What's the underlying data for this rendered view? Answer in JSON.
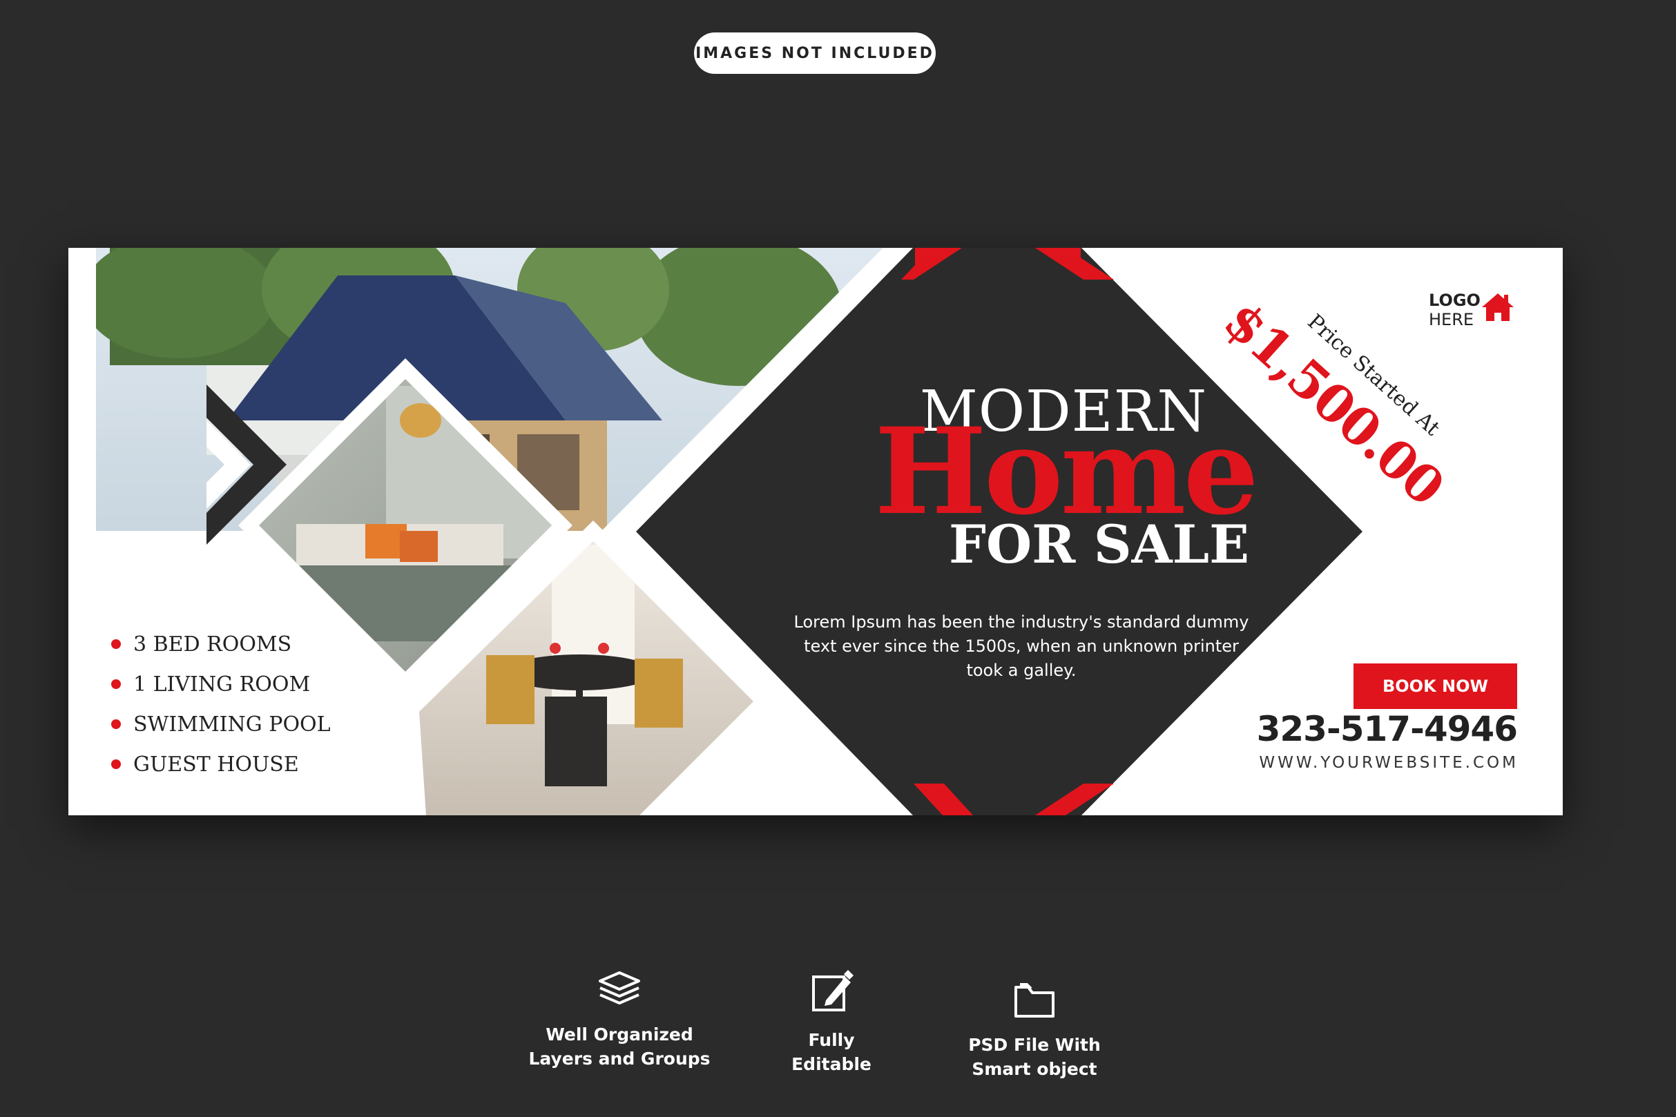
{
  "badge": "IMAGES NOT INCLUDED",
  "banner": {
    "headline_top": "MODERN",
    "headline_main": "Home",
    "headline_bottom": "FOR SALE",
    "description": "Lorem Ipsum has been the industry's standard dummy text ever since the 1500s, when an unknown printer took a galley.",
    "price_label": "Price Started At",
    "price_value": "$1,500.00",
    "logo_line1": "LOGO",
    "logo_line2": "HERE",
    "logo_icon": "house-icon",
    "features": [
      "3 BED ROOMS",
      "1 LIVING ROOM",
      "SWIMMING POOL",
      "GUEST HOUSE"
    ],
    "cta": "BOOK NOW",
    "phone": "323-517-4946",
    "website": "WWW.YOURWEBSITE.COM",
    "images": [
      "house-exterior-photo",
      "bedroom-photo",
      "dining-room-photo"
    ]
  },
  "footer": [
    {
      "icon": "layers-icon",
      "line1": "Well Organized",
      "line2": "Layers and Groups"
    },
    {
      "icon": "edit-icon",
      "line1": "Fully",
      "line2": "Editable"
    },
    {
      "icon": "folder-icon",
      "line1": "PSD File With",
      "line2": "Smart object"
    }
  ],
  "colors": {
    "accent": "#e0141c",
    "dark": "#2b2b2b",
    "white": "#ffffff"
  }
}
